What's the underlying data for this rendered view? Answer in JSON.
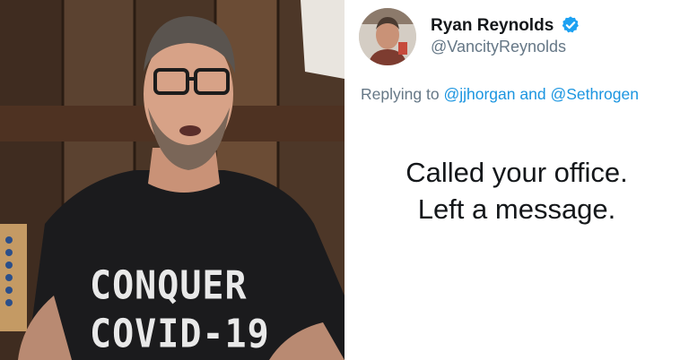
{
  "video": {
    "shirt_line_1": "CONQUER",
    "shirt_line_2": "COVID-19"
  },
  "tweet": {
    "author_name": "Ryan Reynolds",
    "author_handle": "@VancityReynolds",
    "verified_icon": "verified-badge-icon",
    "reply_prefix": "Replying to",
    "reply_mention_1": "@jjhorgan",
    "reply_conjunction": "and",
    "reply_mention_2": "@Sethrogen",
    "body_line_1": "Called your office.",
    "body_line_2": "Left a message.",
    "colors": {
      "name": "#14171a",
      "handle": "#657786",
      "mention": "#1b95e0",
      "verified": "#1da1f2"
    }
  }
}
